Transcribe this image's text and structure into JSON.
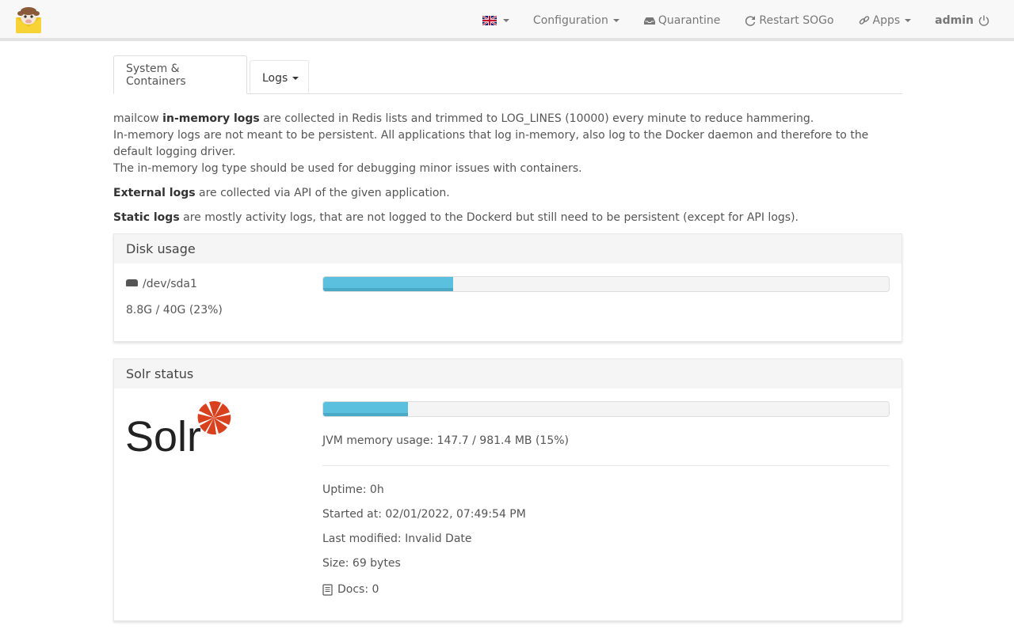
{
  "nav": {
    "configuration": "Configuration",
    "quarantine": "Quarantine",
    "restart_sogo": "Restart SOGo",
    "apps": "Apps",
    "user": "admin"
  },
  "tabs": {
    "system": "System & Containers",
    "logs": "Logs"
  },
  "info": {
    "l1_prefix": "mailcow ",
    "l1_bold": "in-memory logs",
    "l1_rest": " are collected in Redis lists and trimmed to LOG_LINES (10000) every minute to reduce hammering.",
    "l2": "In-memory logs are not meant to be persistent. All applications that log in-memory, also log to the Docker daemon and therefore to the default logging driver.",
    "l3": "The in-memory log type should be used for debugging minor issues with containers.",
    "ext_bold": "External logs",
    "ext_rest": " are collected via API of the given application.",
    "static_bold": "Static logs",
    "static_rest": " are mostly activity logs, that are not logged to the Dockerd but still need to be persistent (except for API logs)."
  },
  "disk": {
    "title": "Disk usage",
    "device": "/dev/sda1",
    "usage": "8.8G / 40G (23%)",
    "percent": 23
  },
  "solr": {
    "title": "Solr status",
    "logo_text": "Solr",
    "jvm": "JVM memory usage: 147.7 / 981.4 MB (15%)",
    "percent": 15,
    "uptime": "Uptime: 0h",
    "started": "Started at: 02/01/2022, 07:49:54 PM",
    "modified": "Last modified: Invalid Date",
    "size": "Size: 69 bytes",
    "docs": "Docs: 0"
  },
  "colors": {
    "progress": "#5bc0de",
    "solr_red": "#d9411e",
    "solr_text": "#222222"
  }
}
